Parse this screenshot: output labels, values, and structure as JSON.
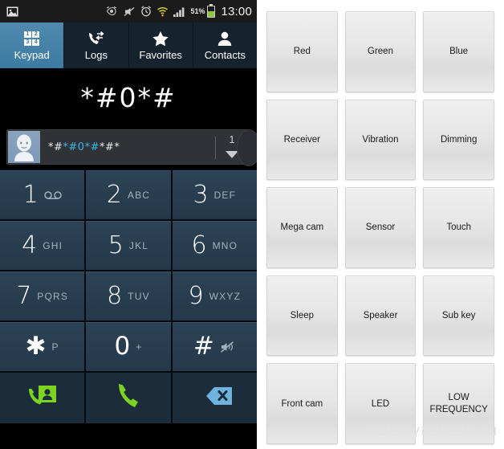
{
  "statusbar": {
    "icons": [
      "image-icon",
      "eye-icon",
      "mute-icon",
      "alarm-icon",
      "wifi-icon",
      "signal-icon"
    ],
    "battery_percent": "51%",
    "clock": "13:00"
  },
  "tabs": [
    {
      "label": "Keypad",
      "icon": "keypad-grid-icon",
      "active": true
    },
    {
      "label": "Logs",
      "icon": "call-logs-icon",
      "active": false
    },
    {
      "label": "Favorites",
      "icon": "star-icon",
      "active": false
    },
    {
      "label": "Contacts",
      "icon": "person-icon",
      "active": false
    }
  ],
  "keypad_icon_digits": [
    "1",
    "2",
    "3",
    "4"
  ],
  "display": {
    "dialed_number": "*#0*#"
  },
  "suggestion": {
    "avatar": "default-contact-avatar",
    "prefix": "*#",
    "match": "*#0*#",
    "suffix": "*#*",
    "full_text": "*#*#0*#*#*",
    "count": "1",
    "expand": "chevron-down-icon"
  },
  "keys": [
    {
      "digit": "1",
      "sub": "voicemail-icon",
      "sub_type": "glyph",
      "sub_text": "∞"
    },
    {
      "digit": "2",
      "sub": "ABC",
      "sub_type": "letters"
    },
    {
      "digit": "3",
      "sub": "DEF",
      "sub_type": "letters"
    },
    {
      "digit": "4",
      "sub": "GHI",
      "sub_type": "letters"
    },
    {
      "digit": "5",
      "sub": "JKL",
      "sub_type": "letters"
    },
    {
      "digit": "6",
      "sub": "MNO",
      "sub_type": "letters"
    },
    {
      "digit": "7",
      "sub": "PQRS",
      "sub_type": "letters"
    },
    {
      "digit": "8",
      "sub": "TUV",
      "sub_type": "letters"
    },
    {
      "digit": "9",
      "sub": "WXYZ",
      "sub_type": "letters"
    },
    {
      "digit": "✱",
      "sub": "P",
      "sub_type": "letters",
      "symbol": true
    },
    {
      "digit": "0",
      "sub": "+",
      "sub_type": "letters",
      "symbol": true
    },
    {
      "digit": "#",
      "sub": "mute-icon",
      "sub_type": "glyph",
      "sub_text": "🔇",
      "symbol": true
    }
  ],
  "actions": [
    {
      "name": "video-call-button",
      "icon": "video-call-icon"
    },
    {
      "name": "call-button",
      "icon": "phone-handset-icon"
    },
    {
      "name": "backspace-button",
      "icon": "backspace-icon"
    }
  ],
  "test_menu": {
    "tiles": [
      "Red",
      "Green",
      "Blue",
      "Receiver",
      "Vibration",
      "Dimming",
      "Mega cam",
      "Sensor",
      "Touch",
      "Sleep",
      "Speaker",
      "Sub key",
      "Front cam",
      "LED",
      "LOW FREQUENCY"
    ],
    "watermark": "Galaxynoteall.ru"
  },
  "colors": {
    "tab_active": "#3f7ba3",
    "key_face": "#2a4053",
    "accent_green": "#7ed321",
    "suggest_highlight": "#35b6e0",
    "battery_fill": "#8ec63f"
  }
}
